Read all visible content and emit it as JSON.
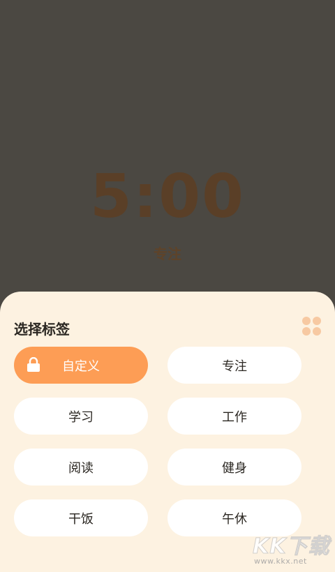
{
  "timer": {
    "time": "5:00",
    "label": "专注"
  },
  "sheet": {
    "title": "选择标签",
    "grid_icon": "grid-icon",
    "tags": [
      {
        "label": "自定义",
        "active": true,
        "icon": "lock-icon"
      },
      {
        "label": "专注",
        "active": false
      },
      {
        "label": "学习",
        "active": false
      },
      {
        "label": "工作",
        "active": false
      },
      {
        "label": "阅读",
        "active": false
      },
      {
        "label": "健身",
        "active": false
      },
      {
        "label": "干饭",
        "active": false
      },
      {
        "label": "午休",
        "active": false
      }
    ]
  },
  "watermark": {
    "brand": "KK下载",
    "url": "www.kkx.net"
  },
  "colors": {
    "background": "#4b4842",
    "timer_text": "#5a3f27",
    "sheet": "#fdf2e1",
    "accent": "#fd9d55",
    "tag": "#ffffff",
    "grid_icon": "#f7c9a2"
  }
}
